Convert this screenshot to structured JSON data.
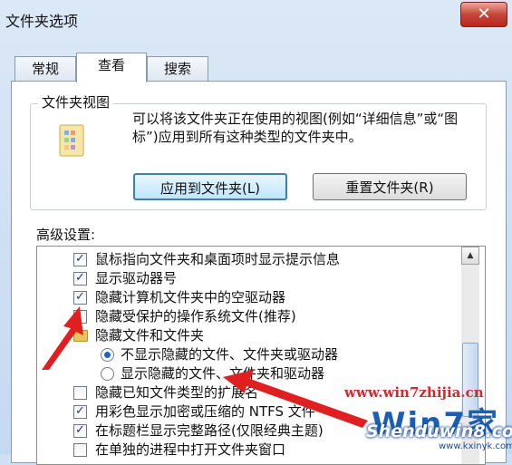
{
  "window": {
    "title": "文件夹选项",
    "close_symbol": "✕"
  },
  "tabs": [
    {
      "label": "常规"
    },
    {
      "label": "查看"
    },
    {
      "label": "搜索"
    }
  ],
  "folder_view": {
    "group_label": "文件夹视图",
    "description": "可以将该文件夹正在使用的视图(例如“详细信息”或“图标”)应用到所有这种类型的文件夹中。",
    "apply_button": "应用到文件夹(L)",
    "reset_button": "重置文件夹(R)",
    "icon": "folder-view-icon"
  },
  "advanced": {
    "label": "高级设置:",
    "items": [
      {
        "label": "鼠标指向文件夹和桌面项时显示提示信息",
        "type": "checkbox",
        "checked": true
      },
      {
        "label": "显示驱动器号",
        "type": "checkbox",
        "checked": true
      },
      {
        "label": "隐藏计算机文件夹中的空驱动器",
        "type": "checkbox",
        "checked": true
      },
      {
        "label": "隐藏受保护的操作系统文件(推荐)",
        "type": "checkbox",
        "checked": false
      },
      {
        "label": "隐藏文件和文件夹",
        "type": "folder"
      },
      {
        "label": "不显示隐藏的文件、文件夹或驱动器",
        "type": "radio",
        "selected": true
      },
      {
        "label": "显示隐藏的文件、文件夹和驱动器",
        "type": "radio",
        "selected": false
      },
      {
        "label": "隐藏已知文件类型的扩展名",
        "type": "checkbox",
        "checked": false
      },
      {
        "label": "用彩色显示加密或压缩的 NTFS 文件",
        "type": "checkbox",
        "checked": true
      },
      {
        "label": "在标题栏显示完整路径(仅限经典主题)",
        "type": "checkbox",
        "checked": true
      },
      {
        "label": "在单独的进程中打开文件夹窗口",
        "type": "checkbox",
        "checked": false
      }
    ]
  },
  "watermark": {
    "url": "www.win7zhijia.cn",
    "logo": "Win7家",
    "brand": "Shenduwin8.com",
    "small": "www.kxinyk.com"
  },
  "colors": {
    "annotation": "#e02020",
    "selected_radio": "#1f63c9"
  }
}
